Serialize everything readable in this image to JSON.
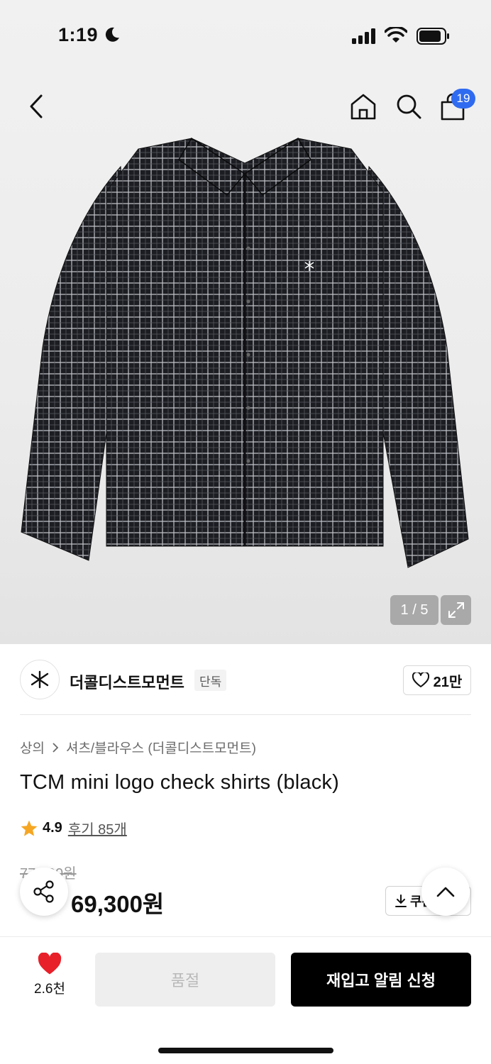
{
  "status_bar": {
    "time": "1:19"
  },
  "nav": {
    "cart_count": "19"
  },
  "gallery": {
    "counter": "1 / 5"
  },
  "brand": {
    "name": "더콜디스트모먼트",
    "badge": "단독",
    "likes": "21만"
  },
  "product": {
    "breadcrumb": {
      "category": "상의",
      "subcategory": "셔츠/블라우스 (더콜디스트모먼트)"
    },
    "title": "TCM mini logo check shirts (black)",
    "rating": "4.9",
    "reviews": "후기 85개",
    "original_price": "77,000원",
    "sale_price": "69,300원",
    "coupon_label": "쿠폰"
  },
  "bottom_bar": {
    "wish_count": "2.6천",
    "soldout_label": "품절",
    "restock_label": "재입고 알림 신청"
  },
  "colors": {
    "accent_blue": "#2f6bf0",
    "heart_red": "#e8202a",
    "star": "#f5a623"
  }
}
